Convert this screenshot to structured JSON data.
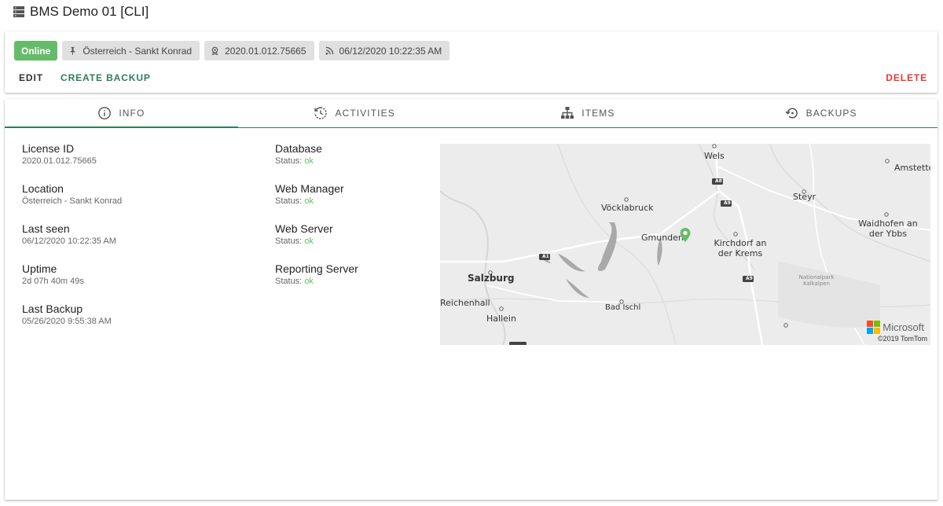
{
  "header": {
    "title": "BMS Demo 01 [CLI]"
  },
  "chips": {
    "status": "Online",
    "location": "Österreich - Sankt Konrad",
    "license": "2020.01.012.75665",
    "last_seen": "06/12/2020 10:22:35 AM"
  },
  "actions": {
    "edit": "EDIT",
    "create_backup": "CREATE BACKUP",
    "delete": "DELETE"
  },
  "tabs": [
    {
      "label": "INFO",
      "icon": "info-icon",
      "active": true
    },
    {
      "label": "ACTIVITIES",
      "icon": "history-icon",
      "active": false
    },
    {
      "label": "ITEMS",
      "icon": "sitemap-icon",
      "active": false
    },
    {
      "label": "BACKUPS",
      "icon": "restore-icon",
      "active": false
    }
  ],
  "info": {
    "license_id": {
      "label": "License ID",
      "value": "2020.01.012.75665"
    },
    "location": {
      "label": "Location",
      "value": "Österreich - Sankt Konrad"
    },
    "last_seen": {
      "label": "Last seen",
      "value": "06/12/2020 10:22:35 AM"
    },
    "uptime": {
      "label": "Uptime",
      "value": "2d 07h 40m 49s"
    },
    "last_backup": {
      "label": "Last Backup",
      "value": "05/26/2020 9:55:38 AM"
    }
  },
  "services": {
    "status_prefix": "Status:",
    "items": [
      {
        "label": "Database",
        "status": "ok"
      },
      {
        "label": "Web Manager",
        "status": "ok"
      },
      {
        "label": "Web Server",
        "status": "ok"
      },
      {
        "label": "Reporting Server",
        "status": "ok"
      }
    ]
  },
  "map": {
    "places": [
      "Wels",
      "Amstetten",
      "Steyr",
      "Vöcklabruck",
      "Gmunden",
      "Kirchdorf an der Krems",
      "Waidhofen an der Ybbs",
      "Salzburg",
      "Reichenhall",
      "Hallein",
      "Bad Ischl"
    ],
    "park_label": "Nationalpark Kalkalpen",
    "roads": [
      "A8",
      "A9",
      "A1",
      "A9"
    ],
    "brand": "Microsoft",
    "copyright": "©2019 TomTom"
  },
  "colors": {
    "accent": "#2e7d5b",
    "status_online": "#66bb6a",
    "delete": "#e53935",
    "ok": "#66bb6a"
  }
}
